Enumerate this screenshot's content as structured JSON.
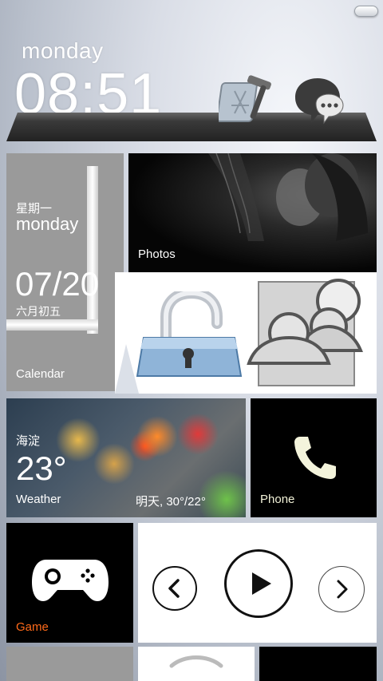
{
  "clock": {
    "day": "monday",
    "time": "08:51"
  },
  "dock_icons": [
    {
      "name": "xcode-icon"
    },
    {
      "name": "messages-icon"
    }
  ],
  "tiles": {
    "calendar": {
      "weekday_cn": "星期一",
      "weekday_en": "monday",
      "date": "07/20",
      "lunar": "六月初五",
      "label": "Calendar"
    },
    "photos": {
      "label": "Photos"
    },
    "weather": {
      "city": "海淀",
      "temp": "23°",
      "label": "Weather",
      "forecast": "明天, 30°/22°"
    },
    "phone": {
      "label": "Phone"
    },
    "game": {
      "label": "Game"
    },
    "player": {
      "prev": "prev-icon",
      "play": "play-icon",
      "next": "next-icon"
    }
  },
  "colors": {
    "game_label": "#ff6a1a",
    "phone_label": "#f2f2d8",
    "tile_gray": "#9a9a9a"
  }
}
